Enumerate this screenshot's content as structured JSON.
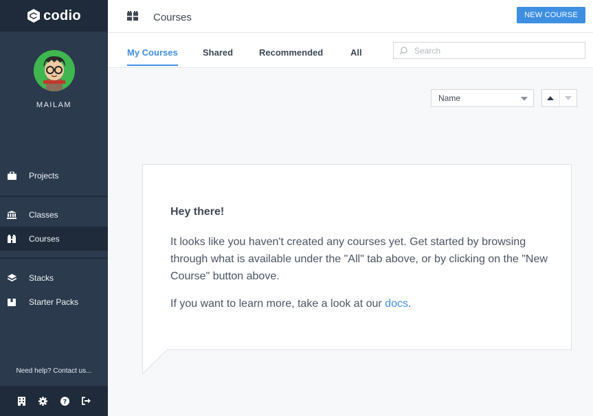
{
  "brand": {
    "name": "codio",
    "icon": "codio-logo"
  },
  "user": {
    "name": "MAILAM"
  },
  "sidebar": {
    "items": [
      {
        "label": "Projects",
        "icon": "briefcase-icon",
        "active": false
      },
      {
        "label": "Classes",
        "icon": "institution-icon",
        "active": false
      },
      {
        "label": "Courses",
        "icon": "courses-icon",
        "active": true
      },
      {
        "label": "Stacks",
        "icon": "layers-icon",
        "active": false
      },
      {
        "label": "Starter Packs",
        "icon": "box-icon",
        "active": false
      }
    ],
    "help_text": "Need help? Contact us...",
    "footer_icons": [
      "building-icon",
      "gear-icon",
      "question-icon",
      "sign-out-icon"
    ]
  },
  "header": {
    "title": "Courses",
    "new_button": "NEW COURSE"
  },
  "tabs": [
    {
      "label": "My Courses",
      "active": true
    },
    {
      "label": "Shared",
      "active": false
    },
    {
      "label": "Recommended",
      "active": false
    },
    {
      "label": "All",
      "active": false
    }
  ],
  "search": {
    "placeholder": "Search",
    "value": ""
  },
  "sort": {
    "selected": "Name"
  },
  "empty_state": {
    "heading": "Hey there!",
    "paragraph": "It looks like you haven't created any courses yet. Get started by browsing through what is available under the \"All\" tab above, or by clicking on the \"New Course\" button above.",
    "learn_prefix": "If you want to learn more, take a look at our ",
    "learn_link": "docs",
    "learn_suffix": "."
  },
  "colors": {
    "sidebar_bg": "#2b3a4d",
    "sidebar_dark": "#1f2b3b",
    "accent": "#3e8fe2",
    "text": "#3d4755"
  }
}
